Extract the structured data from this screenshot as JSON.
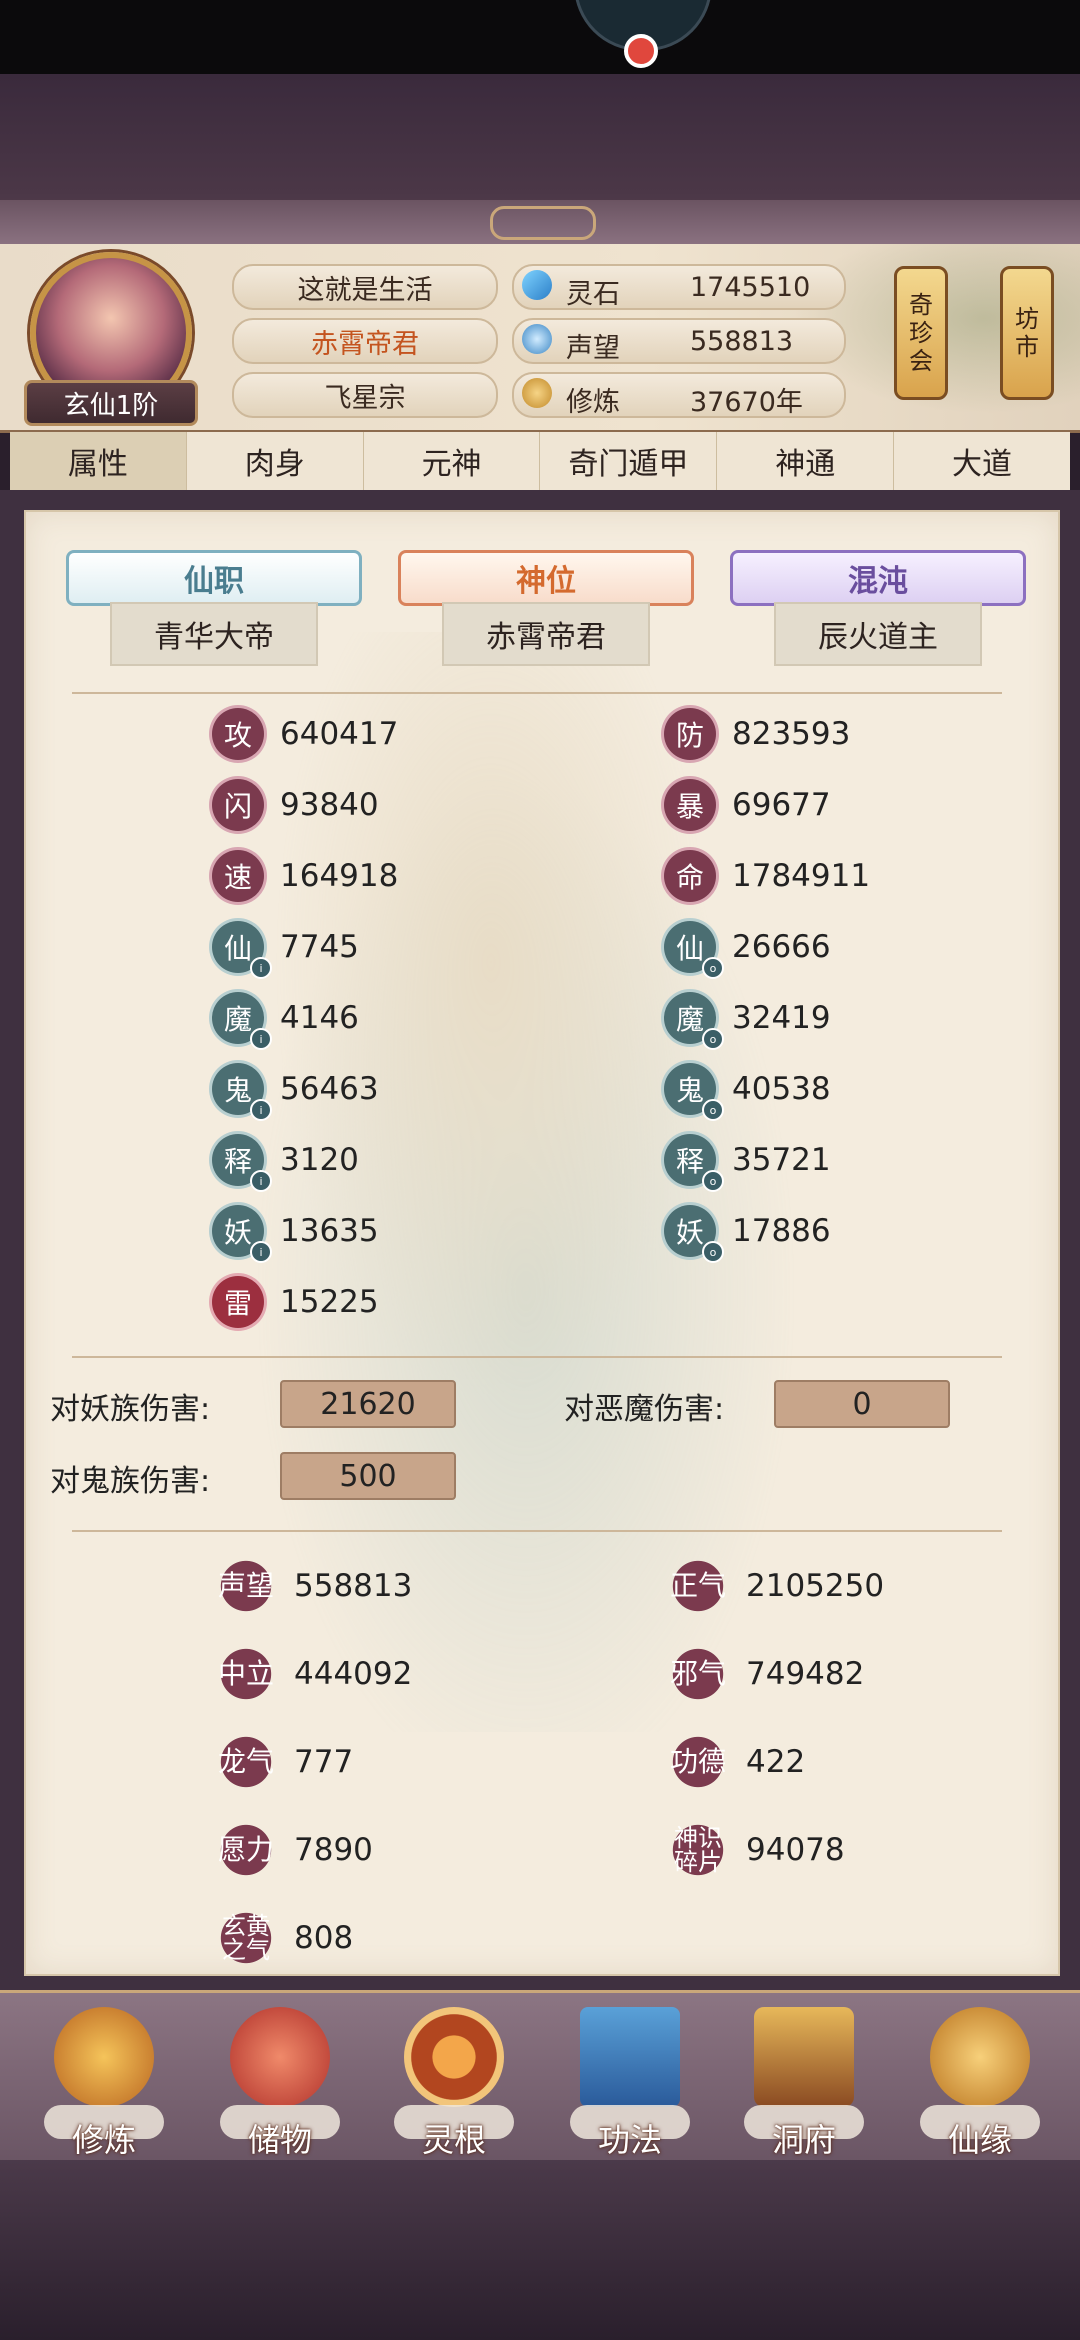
{
  "header": {
    "rank": "玄仙1阶",
    "name": "这就是生活",
    "title": "赤霄帝君",
    "sect": "飞星宗",
    "resources": [
      {
        "icon": "spirit-stone-icon",
        "label": "灵石",
        "value": "1745510"
      },
      {
        "icon": "reputation-drop-icon",
        "label": "声望",
        "value": "558813"
      },
      {
        "icon": "meditation-icon",
        "label": "修炼",
        "value": "37670年"
      }
    ],
    "side_buttons": [
      {
        "label": "奇\n珍\n会"
      },
      {
        "label": "坊\n市"
      }
    ]
  },
  "tabs": [
    {
      "label": "属性",
      "active": true
    },
    {
      "label": "肉身"
    },
    {
      "label": "元神"
    },
    {
      "label": "奇门遁甲"
    },
    {
      "label": "神通"
    },
    {
      "label": "大道"
    }
  ],
  "titles": [
    {
      "banner": "仙职",
      "value": "青华大帝",
      "color": "#4a7d8f"
    },
    {
      "banner": "神位",
      "value": "赤霄帝君",
      "color": "#d46a2e"
    },
    {
      "banner": "混沌",
      "value": "辰火道主",
      "color": "#6a4e9e"
    }
  ],
  "stats_left": [
    {
      "char": "攻",
      "value": "640417"
    },
    {
      "char": "闪",
      "value": "93840"
    },
    {
      "char": "速",
      "value": "164918"
    },
    {
      "char": "仙",
      "value": "7745"
    },
    {
      "char": "魔",
      "value": "4146"
    },
    {
      "char": "鬼",
      "value": "56463"
    },
    {
      "char": "释",
      "value": "3120"
    },
    {
      "char": "妖",
      "value": "13635"
    },
    {
      "char": "雷",
      "value": "15225"
    }
  ],
  "stats_right": [
    {
      "char": "防",
      "value": "823593"
    },
    {
      "char": "暴",
      "value": "69677"
    },
    {
      "char": "命",
      "value": "1784911"
    },
    {
      "char": "仙",
      "value": "26666"
    },
    {
      "char": "魔",
      "value": "32419"
    },
    {
      "char": "鬼",
      "value": "40538"
    },
    {
      "char": "释",
      "value": "35721"
    },
    {
      "char": "妖",
      "value": "17886"
    }
  ],
  "damage": {
    "demon_label": "对妖族伤害:",
    "demon_value": "21620",
    "evil_label": "对恶魔伤害:",
    "evil_value": "0",
    "ghost_label": "对鬼族伤害:",
    "ghost_value": "500"
  },
  "reputation": {
    "left": [
      {
        "label": "声望",
        "value": "558813"
      },
      {
        "label": "中立",
        "value": "444092"
      },
      {
        "label": "龙气",
        "value": "777"
      },
      {
        "label": "愿力",
        "value": "7890"
      },
      {
        "label": "玄黄之气",
        "value": "808"
      }
    ],
    "right": [
      {
        "label": "正气",
        "value": "2105250"
      },
      {
        "label": "邪气",
        "value": "749482"
      },
      {
        "label": "功德",
        "value": "422"
      },
      {
        "label": "神识碎片",
        "value": "94078"
      }
    ]
  },
  "nav": [
    {
      "label": "修炼",
      "icon": "hooded-monk-icon"
    },
    {
      "label": "储物",
      "icon": "storage-bag-icon"
    },
    {
      "label": "灵根",
      "icon": "spirit-root-orb-icon"
    },
    {
      "label": "功法",
      "icon": "scripture-book-icon"
    },
    {
      "label": "洞府",
      "icon": "cave-palace-icon"
    },
    {
      "label": "仙缘",
      "icon": "gourd-icon"
    }
  ]
}
